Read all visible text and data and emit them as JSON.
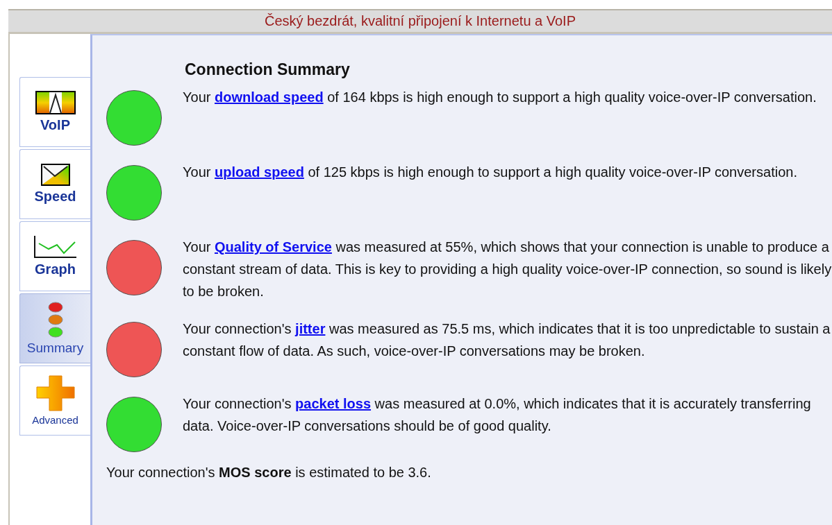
{
  "header": {
    "title": "Český bezdrát, kvalitní připojení k Internetu a VoIP"
  },
  "tabs": [
    {
      "label": "VoIP",
      "kind": "voip",
      "selected": false
    },
    {
      "label": "Speed",
      "kind": "speed",
      "selected": false
    },
    {
      "label": "Graph",
      "kind": "graph",
      "selected": false
    },
    {
      "label": "Summary",
      "kind": "summary",
      "selected": true
    },
    {
      "label": "Advanced",
      "kind": "advanced",
      "selected": false
    }
  ],
  "summary": {
    "title": "Connection Summary",
    "results": [
      {
        "color": "#33dd33",
        "prefix": "Your",
        "link": "download speed",
        "suffix": "of 164 kbps is high enough to support a high quality voice-over-IP conversation."
      },
      {
        "color": "#33dd33",
        "prefix": "Your",
        "link": "upload speed",
        "suffix": "of 125 kbps is high enough to support a high quality voice-over-IP conversation."
      },
      {
        "color": "#ee5555",
        "prefix": "Your",
        "link": "Quality of Service",
        "suffix": "was measured at 55%, which shows that your connection is unable to produce a constant stream of data. This is key to providing a high quality voice-over-IP connection, so sound is likely to be broken."
      },
      {
        "color": "#ee5555",
        "prefix": "Your connection's",
        "link": "jitter",
        "suffix": "was measured as 75.5 ms, which indicates that it is too unpredictable to sustain a constant flow of data. As such, voice-over-IP conversations may be broken."
      },
      {
        "color": "#33dd33",
        "prefix": "Your connection's",
        "link": "packet loss",
        "suffix": "was measured at 0.0%, which indicates that it is accurately transferring data. Voice-over-IP conversations should be of good quality."
      }
    ],
    "mos": "Your connection's **MOS score** is estimated to be 3.6."
  }
}
